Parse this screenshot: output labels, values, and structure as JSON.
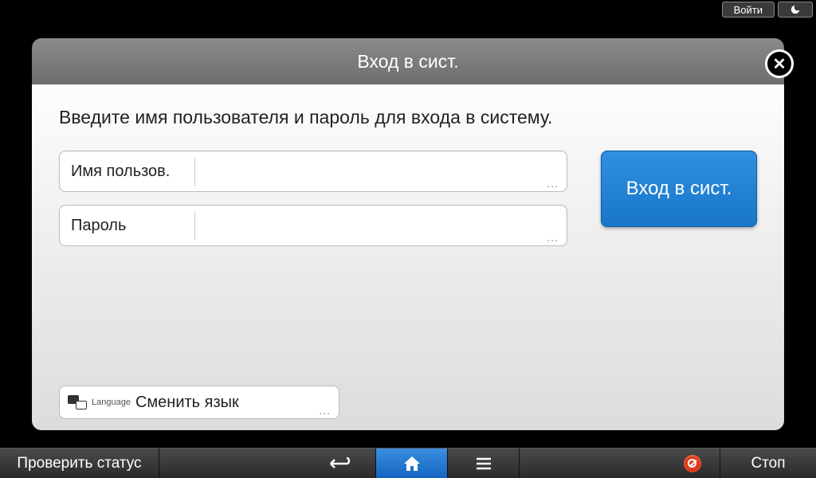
{
  "topbar": {
    "login_label": "Войти"
  },
  "dialog": {
    "title": "Вход в сист.",
    "instruction": "Введите имя пользователя и пароль для входа в систему.",
    "username_label": "Имя пользов.",
    "username_value": "",
    "password_label": "Пароль",
    "password_value": "",
    "submit_label": "Вход в сист.",
    "language_small": "Language",
    "language_label": "Сменить язык"
  },
  "bottombar": {
    "status_label": "Проверить статус",
    "stop_label": "Стоп"
  }
}
